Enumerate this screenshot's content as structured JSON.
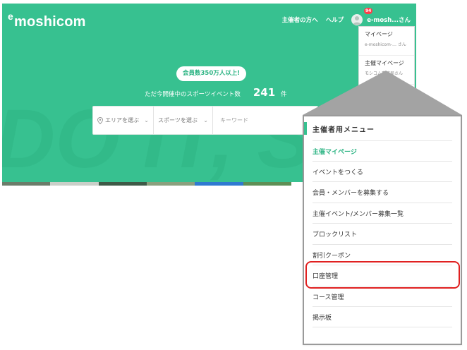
{
  "app": {
    "logo_mark": "e",
    "logo_text": "moshicom"
  },
  "topnav": {
    "organizer_link": "主催者の方へ",
    "help_link": "ヘルプ",
    "user_name": "e-mosh...さん",
    "notification_count": "94"
  },
  "hero": {
    "members_badge": "会員数350万人以上!",
    "event_prefix": "ただ今開催中のスポーツイベント数",
    "event_count": "241",
    "event_unit": "件",
    "watermark_text": "DO IT, SPORTS"
  },
  "search": {
    "area_placeholder": "エリアを選ぶ",
    "sport_placeholder": "スポーツを選ぶ",
    "keyword_placeholder": "キーワード"
  },
  "user_dropdown": {
    "items": [
      {
        "label": "マイページ",
        "sub": "e-moshicom-… さん"
      },
      {
        "label": "主催マイページ",
        "sub": "モシコム事務局さん"
      }
    ]
  },
  "organizer_menu": {
    "title": "主催者用メニュー",
    "items": [
      {
        "label": "主催マイページ",
        "active": true
      },
      {
        "label": "イベントをつくる"
      },
      {
        "label": "会員・メンバーを募集する"
      },
      {
        "label": "主催イベント/メンバー募集一覧"
      },
      {
        "label": "ブロックリスト"
      },
      {
        "label": "割引クーポン"
      },
      {
        "label": "口座管理",
        "highlighted": true
      },
      {
        "label": "コース管理"
      },
      {
        "label": "掲示板"
      }
    ]
  },
  "colors": {
    "brand_green": "#37c190",
    "highlight_red": "#e02020",
    "badge_red": "#ff3b48"
  }
}
